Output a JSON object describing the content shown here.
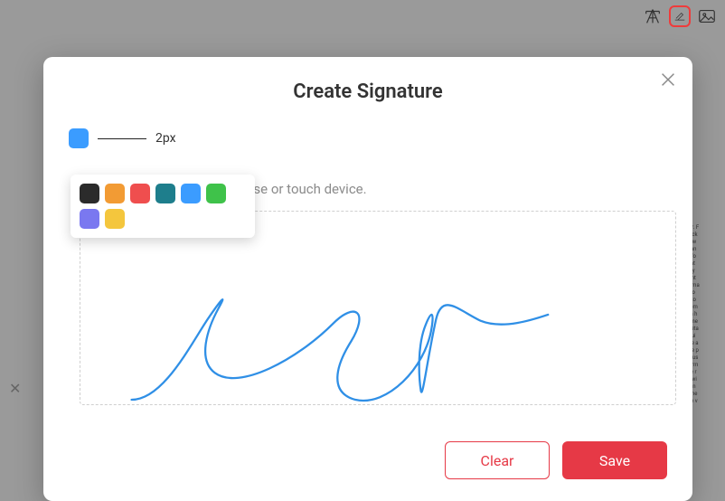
{
  "toolbar": {
    "icons": {
      "text": "text-tool-icon",
      "sign": "sign-tool-icon",
      "image": "image-tool-icon"
    }
  },
  "modal": {
    "title": "Create Signature",
    "instruction": "Sign with your trackpad, mouse or touch device.",
    "stroke_label": "2px",
    "buttons": {
      "clear": "Clear",
      "save": "Save"
    }
  },
  "colors": {
    "selected": "#3b9cff",
    "palette": [
      "#2b2b2b",
      "#f29b34",
      "#ef4e4e",
      "#1e7e8c",
      "#3b9cff",
      "#3fc24a",
      "#7a78f0",
      "#f4c63d"
    ]
  },
  "bg_text_lines": [
    "e another. F",
    "ofile attack",
    "aster, as w",
    "Kitronik an",
    "",
    "rease in fo",
    "ly chain at",
    "rt in many",
    "s code ont",
    "of Ticketma",
    "rty chatbo",
    "rs of visito",
    "ing custom",
    "",
    "ttacks on h",
    "ec's teleme",
    "n sized reta",
    "ening equi",
    "king code a",
    "n with the p",
    "ts from cus",
    "",
    "wth in form",
    "rop in the r",
    "riminals wi",
    "w be optin",
    "tails on the",
    "t than the v"
  ]
}
